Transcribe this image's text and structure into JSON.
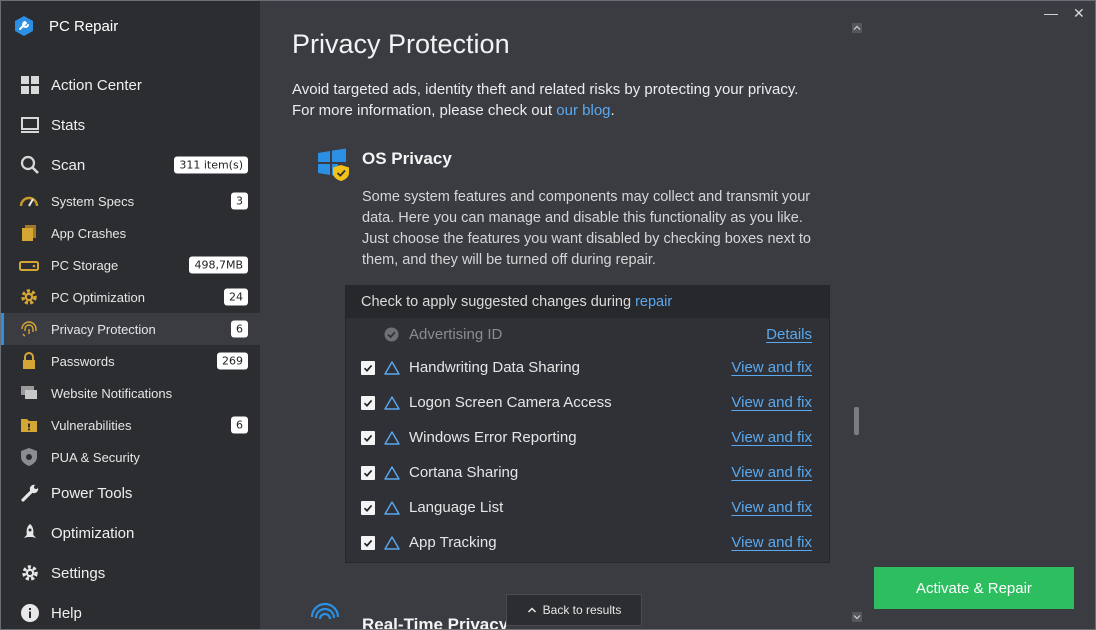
{
  "app": {
    "name": "PC Repair"
  },
  "window": {
    "minimize_glyph": "—",
    "close_glyph": "✕"
  },
  "colors": {
    "accent": "#2b8fe3",
    "link": "#5aa9f0",
    "warning": "#f2c21b",
    "activate": "#2dbe60",
    "sidebar_bg": "#2b2d31",
    "main_bg": "#3a3c42"
  },
  "sidebar": {
    "items": [
      {
        "label": "Action Center",
        "icon": "grid-icon",
        "type": "main"
      },
      {
        "label": "Stats",
        "icon": "monitor-icon",
        "type": "main"
      },
      {
        "label": "Scan",
        "icon": "search-icon",
        "type": "main",
        "badge": "311 item(s)"
      },
      {
        "label": "System Specs",
        "icon": "gauge-icon",
        "type": "sub",
        "badge": "3"
      },
      {
        "label": "App Crashes",
        "icon": "files-icon",
        "type": "sub"
      },
      {
        "label": "PC Storage",
        "icon": "drive-icon",
        "type": "sub",
        "badge": "498,7MB"
      },
      {
        "label": "PC Optimization",
        "icon": "gear-icon",
        "type": "sub",
        "badge": "24"
      },
      {
        "label": "Privacy Protection",
        "icon": "fingerprint-icon",
        "type": "sub",
        "badge": "6",
        "active": true
      },
      {
        "label": "Passwords",
        "icon": "lock-icon",
        "type": "sub",
        "badge": "269"
      },
      {
        "label": "Website Notifications",
        "icon": "chat-icon",
        "type": "sub"
      },
      {
        "label": "Vulnerabilities",
        "icon": "folder-warning-icon",
        "type": "sub",
        "badge": "6"
      },
      {
        "label": "PUA & Security",
        "icon": "shield-icon",
        "type": "sub"
      },
      {
        "label": "Power Tools",
        "icon": "wrench-icon",
        "type": "main"
      },
      {
        "label": "Optimization",
        "icon": "rocket-icon",
        "type": "main"
      },
      {
        "label": "Settings",
        "icon": "gear-icon",
        "type": "main"
      },
      {
        "label": "Help",
        "icon": "info-icon",
        "type": "main"
      }
    ]
  },
  "main": {
    "title": "Privacy Protection",
    "intro_line1": "Avoid targeted ads, identity theft and related risks by protecting your privacy.",
    "intro_line2_prefix": "For more information, please check out ",
    "intro_link": "our blog",
    "intro_line2_suffix": ".",
    "section": {
      "title": "OS Privacy",
      "icon": "windows-shield-icon",
      "description": "Some system features and components may collect and transmit your data. Here you can manage and disable this functionality as you like. Just choose the features you want disabled by checking boxes next to them, and they will be turned off during repair."
    },
    "panel": {
      "header_prefix": "Check to apply suggested changes during ",
      "header_link": "repair",
      "resolved": {
        "label": "Advertising ID",
        "link": "Details"
      },
      "items": [
        {
          "label": "Handwriting Data Sharing",
          "link": "View and fix",
          "checked": true
        },
        {
          "label": "Logon Screen Camera Access",
          "link": "View and fix",
          "checked": true
        },
        {
          "label": "Windows Error Reporting",
          "link": "View and fix",
          "checked": true
        },
        {
          "label": "Cortana Sharing",
          "link": "View and fix",
          "checked": true
        },
        {
          "label": "Language List",
          "link": "View and fix",
          "checked": true
        },
        {
          "label": "App Tracking",
          "link": "View and fix",
          "checked": true
        }
      ]
    },
    "next_section": {
      "title": "Real-Time Privacy",
      "icon": "fingerprint-icon"
    },
    "back_button": "Back to results",
    "back_icon": "chevron-up-icon",
    "activate_button": "Activate & Repair"
  }
}
